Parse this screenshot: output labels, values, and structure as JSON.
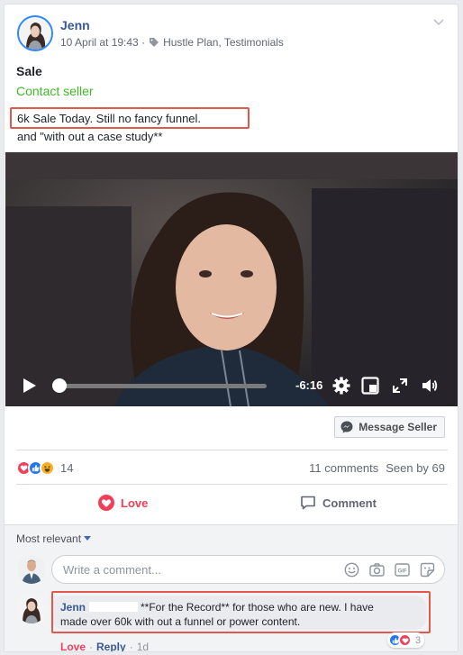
{
  "post": {
    "author": "Jenn",
    "meta": "10 April at 19:43 · ",
    "tags": "Hustle Plan, Testimonials",
    "title": "Sale",
    "contact_label": "Contact seller",
    "text_line1": "6k Sale Today. Still no fancy funnel.",
    "text_line2": "and \"with out a case study**"
  },
  "video": {
    "time_remaining": "-6:16",
    "progress": 0.02
  },
  "message_seller_label": "Message Seller",
  "reactions": {
    "count": "14",
    "comments": "11 comments",
    "seen": "Seen by 69",
    "types": [
      "love-icon",
      "like-icon",
      "haha-icon"
    ]
  },
  "actions": {
    "love_label": "Love",
    "comment_label": "Comment"
  },
  "comments": {
    "sort_label": "Most relevant",
    "input_placeholder": "Write a comment...",
    "items": [
      {
        "author": "Jenn",
        "text_a": "**For the Record** for those who are new. I have",
        "text_b": "made over 60k with out a funnel or power content.",
        "love_label": "Love",
        "reply_label": "Reply",
        "age": "1d",
        "reaction_count": "3"
      }
    ]
  },
  "colors": {
    "accent_blue": "#385898",
    "love_red": "#f33e58",
    "contact_green": "#42b72a",
    "highlight_box": "#e2584d"
  }
}
